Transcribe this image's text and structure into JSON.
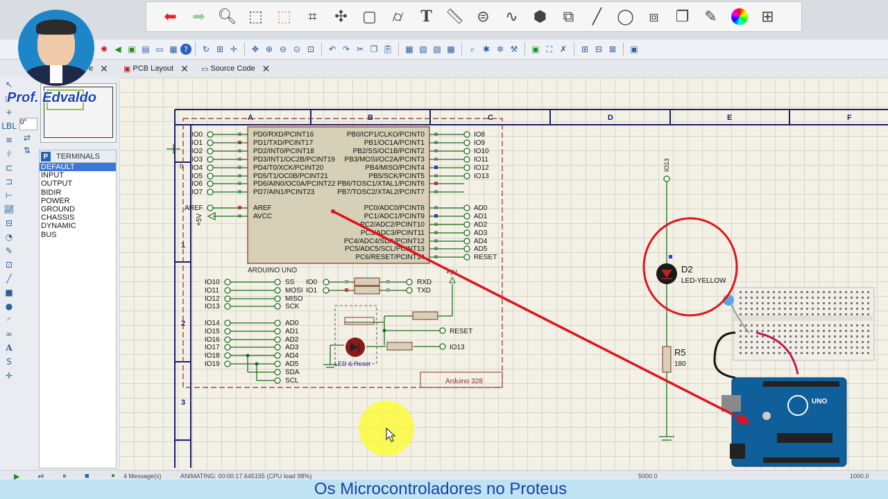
{
  "presenter": {
    "name": "Prof. Edvaldo"
  },
  "tabs": [
    {
      "label": "e"
    },
    {
      "label": "PCB Layout"
    },
    {
      "label": "Source Code"
    }
  ],
  "side": {
    "rotation": "0°",
    "terminals_title": "TERMINALS",
    "terminals": [
      "DEFAULT",
      "INPUT",
      "OUTPUT",
      "BIDIR",
      "POWER",
      "GROUND",
      "CHASSIS",
      "DYNAMIC",
      "BUS"
    ]
  },
  "sheet": {
    "columns": [
      "A",
      "B",
      "C",
      "D",
      "E",
      "F"
    ],
    "rows": [
      "1",
      "2",
      "3"
    ]
  },
  "chip": {
    "title": "ARDUINO UNO",
    "left_pins": [
      "PD0/RXD/PCINT16",
      "PD1/TXD/PCINT17",
      "PD2/INT0/PCINT18",
      "PD3/INT1/OC2B/PCINT19",
      "PD4/T0/XCK/PCINT20",
      "PD5/T1/OC0B/PCINT21",
      "PD6/AIN0/OC0A/PCINT22",
      "PD7/AIN1/PCINT23"
    ],
    "left_nets": [
      "IO0",
      "IO1",
      "IO2",
      "IO3",
      "IO4",
      "IO5",
      "IO6",
      "IO7"
    ],
    "right_pins": [
      "PB0/ICP1/CLKO/PCINT0",
      "PB1/OC1A/PCINT1",
      "PB2/SS/OC1B/PCINT2",
      "PB3/MOSI/OC2A/PCINT3",
      "PB4/MISO/PCINT4",
      "PB5/SCK/PCINT5",
      "PB6/TOSC1/XTAL1/PCINT6",
      "PB7/TOSC2/XTAL2/PCINT7"
    ],
    "right_nets": [
      "IO8",
      "IO9",
      "IO10",
      "IO11",
      "IO12",
      "IO13"
    ],
    "aref_pins": [
      "AREF",
      "AVCC"
    ],
    "aref_nets": [
      "AREF",
      "+5V"
    ],
    "analog_pins": [
      "PC0/ADC0/PCINT8",
      "PC1/ADC1/PCINT9",
      "PC2/ADC2/PCINT10",
      "PC3/ADC3/PCINT11",
      "PC4/ADC4/SDA/PCINT12",
      "PC5/ADC5/SCL/PCINT13",
      "PC6/RESET/PCINT14"
    ],
    "analog_nets": [
      "AD0",
      "AD1",
      "AD2",
      "AD3",
      "AD4",
      "AD5",
      "RESET"
    ]
  },
  "lower": {
    "spi_left": [
      "IO10",
      "IO11",
      "IO12",
      "IO13"
    ],
    "spi_right": [
      "SS",
      "MOSI",
      "MISO",
      "SCK"
    ],
    "serial_left": [
      "IO0",
      "IO1"
    ],
    "serial_right": [
      "RXD",
      "TXD"
    ],
    "ad_left": [
      "IO14",
      "IO15",
      "IO16",
      "IO17",
      "IO18",
      "IO19"
    ],
    "ad_right": [
      "AD0",
      "AD1",
      "AD2",
      "AD3",
      "AD4",
      "AD5",
      "SDA",
      "SCL"
    ],
    "reset_label": "RESET",
    "io13_label": "IO13",
    "vcc_label": "+5V",
    "block_label": "LED & Reset",
    "board_label": "Arduino 328"
  },
  "circuit": {
    "terminal_label": "IO13",
    "led_ref": "D2",
    "led_value": "LED-YELLOW",
    "res_ref": "R5",
    "res_value": "180"
  },
  "status": {
    "messages": "4 Message(s)",
    "animating": "ANIMATING: 00:00:17.645155 (CPU load 98%)",
    "coord_x": "5000.0",
    "coord_y": "1000.0"
  },
  "caption": "Os Microcontroladores  no Proteus",
  "colors": {
    "annotation_red": "#e0121b",
    "caption_blue": "#1a3faa",
    "wire_green": "#1b6b1b",
    "chip_fill": "#d5d0b6"
  }
}
